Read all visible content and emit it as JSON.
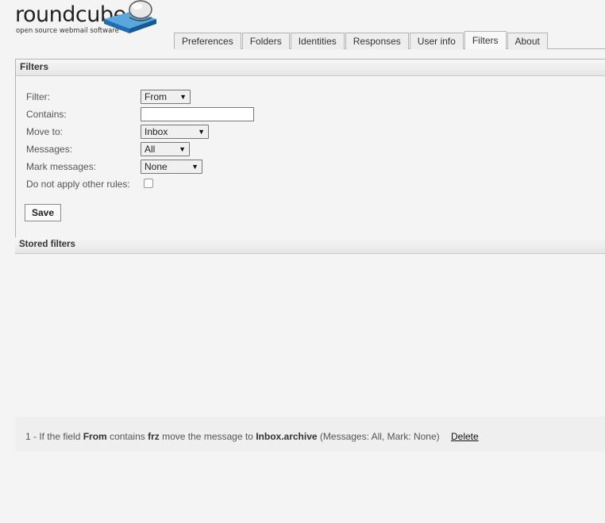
{
  "brand": {
    "name": "roundcube",
    "tagline": "open source webmail software"
  },
  "tabs": [
    {
      "label": "Preferences",
      "active": false
    },
    {
      "label": "Folders",
      "active": false
    },
    {
      "label": "Identities",
      "active": false
    },
    {
      "label": "Responses",
      "active": false
    },
    {
      "label": "User info",
      "active": false
    },
    {
      "label": "Filters",
      "active": true
    },
    {
      "label": "About",
      "active": false
    }
  ],
  "filters_panel": {
    "title": "Filters",
    "filter_label": "Filter:",
    "filter_value": "From",
    "contains_label": "Contains:",
    "contains_value": "",
    "move_to_label": "Move to:",
    "move_to_value": "Inbox",
    "messages_label": "Messages:",
    "messages_value": "All",
    "mark_label": "Mark messages:",
    "mark_value": "None",
    "no_other_rules_label": "Do not apply other rules:",
    "no_other_rules_checked": false,
    "save_label": "Save"
  },
  "stored": {
    "title": "Stored filters",
    "items": [
      {
        "prefix": "1 - If the field",
        "field": "From",
        "contains_word": "contains",
        "value": "frz",
        "move_word": "move the message to",
        "folder": "Inbox.archive",
        "details": "(Messages: All, Mark: None)",
        "delete_label": "Delete"
      }
    ]
  },
  "colors": {
    "background": "#f4f4f4",
    "logo_blue": "#1f6fb0"
  },
  "icons": {
    "select_arrow": "dropdown-arrow-icon",
    "logo": "roundcube-cube-logo"
  }
}
